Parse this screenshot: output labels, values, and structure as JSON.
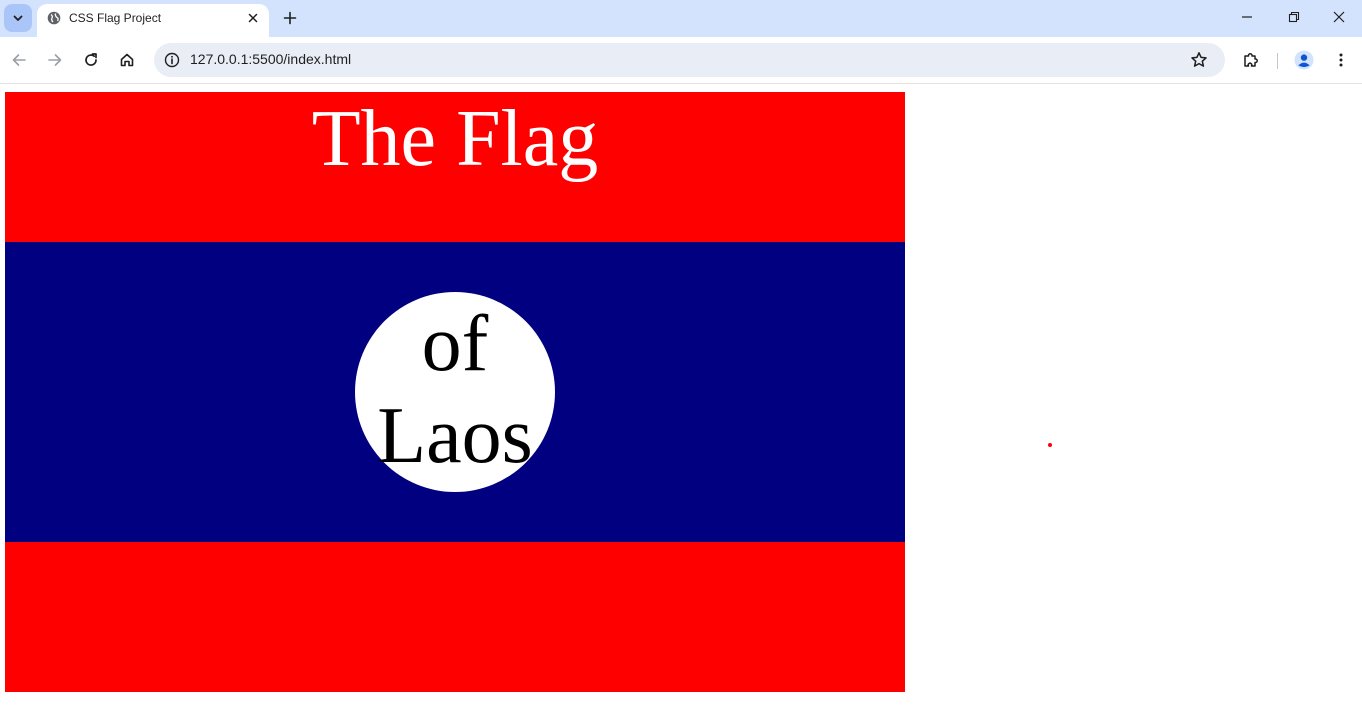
{
  "browser": {
    "tab": {
      "title": "CSS Flag Project",
      "favicon": "globe-icon"
    },
    "address": {
      "url": "127.0.0.1:5500/index.html"
    },
    "colors": {
      "frame": "#d3e3fd",
      "omnibox": "#e9eef6",
      "profile": "#0b57d0"
    }
  },
  "page": {
    "heading": "The Flag",
    "circle_text": "of Laos",
    "colors": {
      "red": "#ff0000",
      "blue": "#000080",
      "white": "#ffffff"
    }
  }
}
